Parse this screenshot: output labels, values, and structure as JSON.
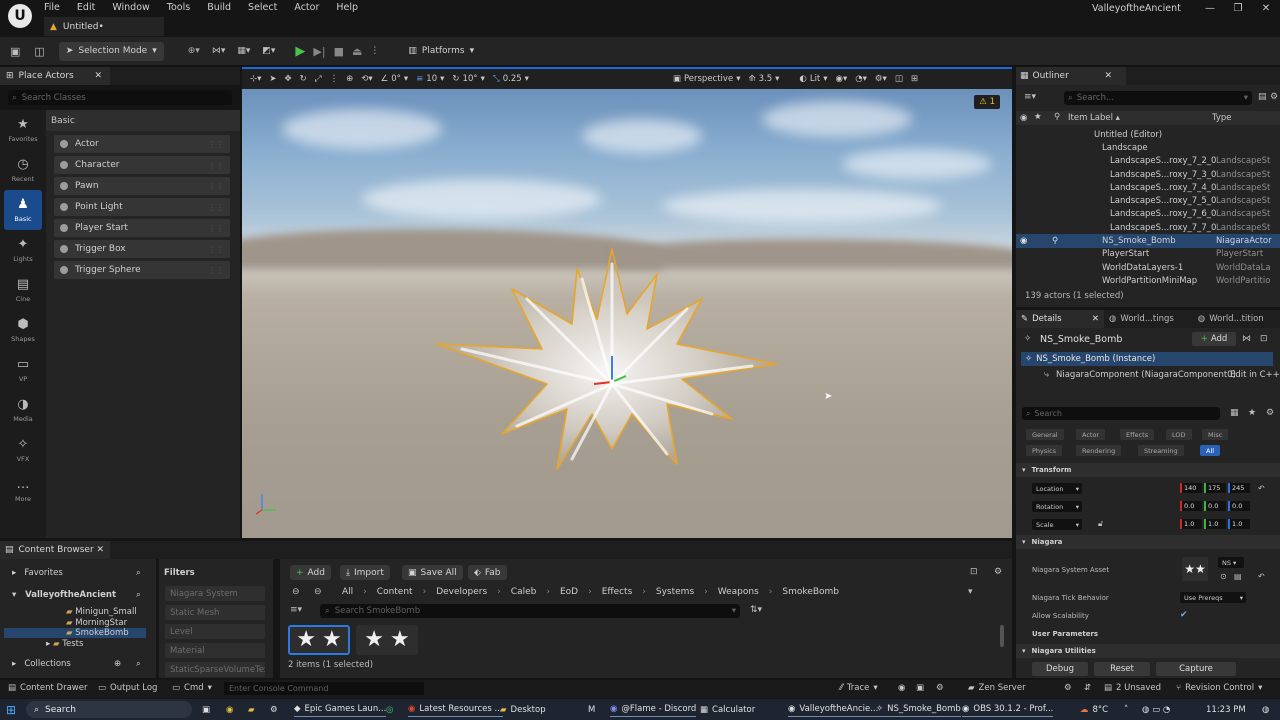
{
  "menubar": {
    "logo_glyph": "U",
    "menus": [
      "File",
      "Edit",
      "Window",
      "Tools",
      "Build",
      "Select",
      "Actor",
      "Help"
    ],
    "project_name": "ValleyoftheAncient",
    "win_min": "—",
    "win_max": "❐",
    "win_close": "✕"
  },
  "doc_tab": {
    "label": "Untitled•"
  },
  "toolbar": {
    "selection_mode": "Selection Mode",
    "platforms": "Platforms"
  },
  "place_actors": {
    "tab_label": "Place Actors",
    "search_placeholder": "Search Classes",
    "category": "Basic",
    "items": [
      "Actor",
      "Character",
      "Pawn",
      "Point Light",
      "Player Start",
      "Trigger Box",
      "Trigger Sphere"
    ]
  },
  "leftbar": {
    "items": [
      {
        "label": "Favorites",
        "glyph": "★"
      },
      {
        "label": "Recent",
        "glyph": "◷"
      },
      {
        "label": "Basic",
        "glyph": "♟"
      },
      {
        "label": "Lights",
        "glyph": "✦"
      },
      {
        "label": "Cine",
        "glyph": "▤"
      },
      {
        "label": "Shapes",
        "glyph": "⬢"
      },
      {
        "label": "VP",
        "glyph": "▭"
      },
      {
        "label": "Media",
        "glyph": "◑"
      },
      {
        "label": "VFX",
        "glyph": "✧"
      },
      {
        "label": "More",
        "glyph": "…"
      }
    ]
  },
  "viewport": {
    "snap_rot": "0°",
    "snap_grid": "10",
    "snap_angle": "10°",
    "scale": "0.25",
    "view_mode": "Perspective",
    "cam_speed": "3.5",
    "lit": "Lit",
    "warning_count": "1"
  },
  "outliner": {
    "tab_label": "Outliner",
    "search_placeholder": "Search...",
    "col_label": "Item Label ▴",
    "col_type": "Type",
    "rows": [
      {
        "label": "Untitled (Editor)",
        "type": "",
        "indent": 78,
        "selected": false
      },
      {
        "label": "Landscape",
        "type": "",
        "indent": 86,
        "selected": false
      },
      {
        "label": "LandscapeS...roxy_7_2_0",
        "type": "LandscapeSt",
        "indent": 94,
        "selected": false
      },
      {
        "label": "LandscapeS...roxy_7_3_0",
        "type": "LandscapeSt",
        "indent": 94,
        "selected": false
      },
      {
        "label": "LandscapeS...roxy_7_4_0",
        "type": "LandscapeSt",
        "indent": 94,
        "selected": false
      },
      {
        "label": "LandscapeS...roxy_7_5_0",
        "type": "LandscapeSt",
        "indent": 94,
        "selected": false
      },
      {
        "label": "LandscapeS...roxy_7_6_0",
        "type": "LandscapeSt",
        "indent": 94,
        "selected": false
      },
      {
        "label": "LandscapeS...roxy_7_7_0",
        "type": "LandscapeSt",
        "indent": 94,
        "selected": false
      },
      {
        "label": "NS_Smoke_Bomb",
        "type": "NiagaraActor",
        "indent": 86,
        "selected": true
      },
      {
        "label": "PlayerStart",
        "type": "PlayerStart",
        "indent": 86,
        "selected": false
      },
      {
        "label": "WorldDataLayers-1",
        "type": "WorldDataLa",
        "indent": 86,
        "selected": false
      },
      {
        "label": "WorldPartitionMiniMap",
        "type": "WorldPartitio",
        "indent": 86,
        "selected": false
      }
    ],
    "footer": "139 actors (1 selected)"
  },
  "details": {
    "tabs": [
      "Details",
      "World...tings",
      "World...tition"
    ],
    "actor_name": "NS_Smoke_Bomb",
    "add_label": "Add",
    "instance": "NS_Smoke_Bomb (Instance)",
    "component": "NiagaraComponent (NiagaraComponent0)",
    "edit_cpp": "Edit in C++",
    "search_placeholder": "Search",
    "filters_row1": [
      "General",
      "Actor",
      "Effects",
      "LOD",
      "Misc"
    ],
    "filters_row2": [
      "Physics",
      "Rendering",
      "Streaming",
      "All"
    ],
    "transform_header": "Transform",
    "location_label": "Location",
    "rotation_label": "Rotation",
    "scale_label": "Scale",
    "location": [
      "140",
      "175",
      "245"
    ],
    "rotation": [
      "0.0",
      "0.0",
      "0.0"
    ],
    "scale": [
      "1.0",
      "1.0",
      "1.0"
    ],
    "niagara_header": "Niagara",
    "system_asset_label": "Niagara System Asset",
    "system_asset_value": "NS",
    "tick_label": "Niagara Tick Behavior",
    "tick_value": "Use Prereqs",
    "scalability_label": "Allow Scalability",
    "user_params": "User Parameters",
    "utilities_header": "Niagara Utilities",
    "btn_debug": "Debug",
    "btn_reset": "Reset",
    "btn_capture": "Capture"
  },
  "content_browser": {
    "tab_label": "Content Browser",
    "favorites": "Favorites",
    "project": "ValleyoftheAncient",
    "tree": [
      "Minigun_Small",
      "MorningStar",
      "SmokeBomb",
      "Tests"
    ],
    "collections": "Collections",
    "filters_title": "Filters",
    "filters": [
      "Niagara System",
      "Static Mesh",
      "Level",
      "Material",
      "StaticSparseVolumeTex"
    ],
    "btn_add": "Add",
    "btn_import": "Import",
    "btn_save_all": "Save All",
    "btn_fab": "Fab",
    "path": [
      "All",
      "Content",
      "Developers",
      "Caleb",
      "EoD",
      "Effects",
      "Systems",
      "Weapons",
      "SmokeBomb"
    ],
    "search_placeholder": "Search SmokeBomb",
    "items_count": "2 items (1 selected)"
  },
  "statusbar": {
    "content_drawer": "Content Drawer",
    "output_log": "Output Log",
    "cmd": "Cmd",
    "console_placeholder": "Enter Console Command",
    "trace": "Trace",
    "zen_server": "Zen Server",
    "unsaved": "2 Unsaved",
    "revision": "Revision Control"
  },
  "taskbar": {
    "search": "Search",
    "apps": [
      "Epic Games Laun...",
      "Latest Resources ...",
      "Desktop",
      "@Flame - Discord",
      "Calculator",
      "ValleyoftheAncie...",
      "NS_Smoke_Bomb",
      "OBS 30.1.2 - Prof..."
    ],
    "temp": "8°C",
    "time": "11:23 PM"
  },
  "colors": {
    "accent": "#1a6ad8",
    "selection": "#26466e",
    "outline_orange": "#e8a628"
  }
}
